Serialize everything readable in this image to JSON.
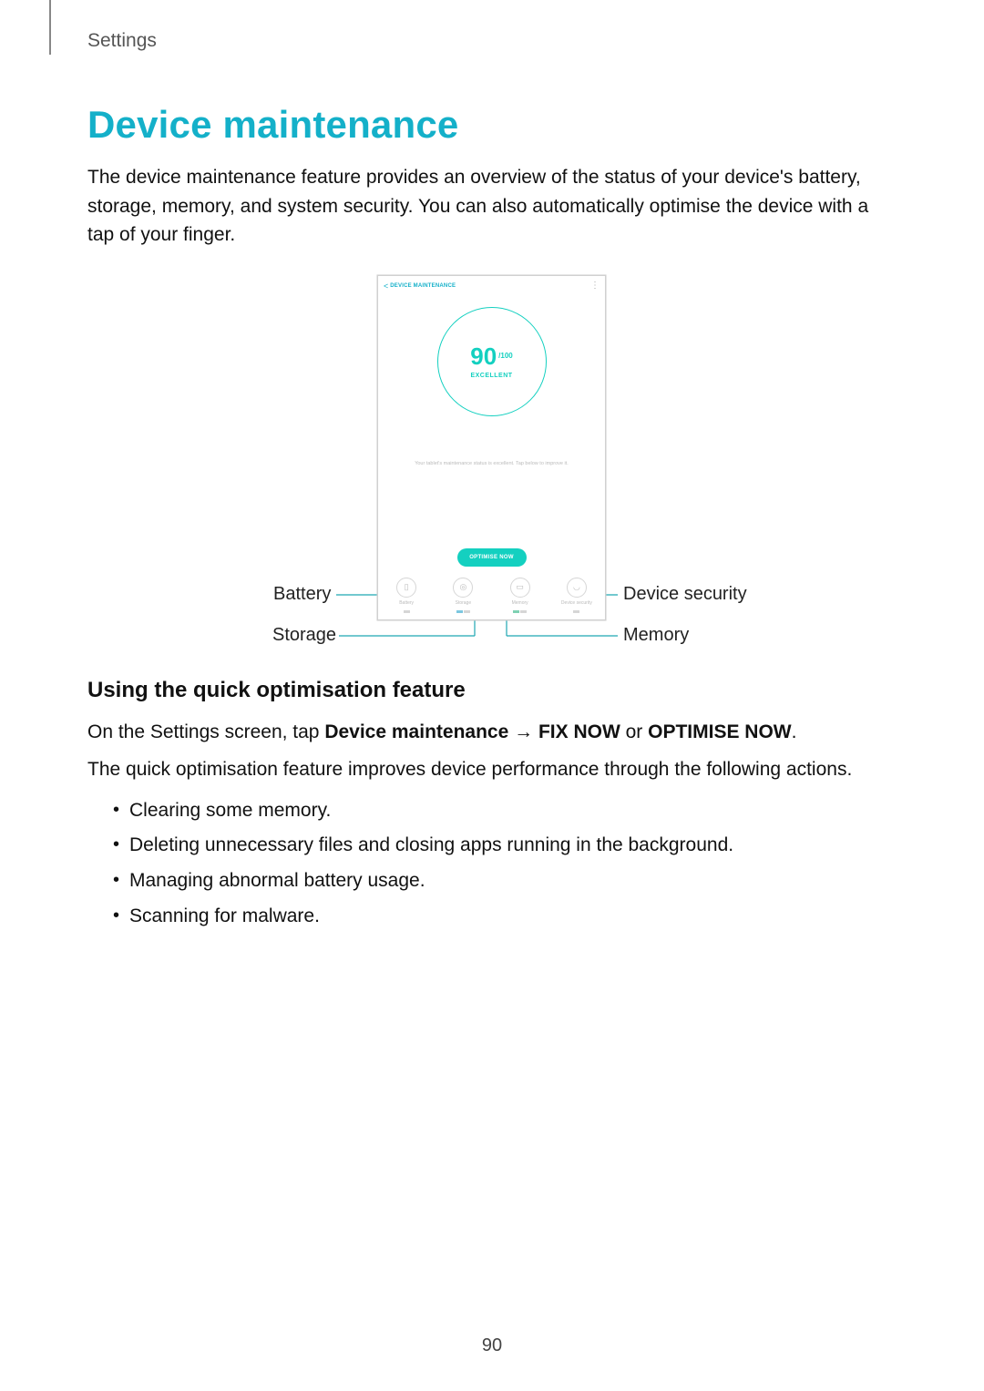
{
  "breadcrumb": "Settings",
  "heading": "Device maintenance",
  "intro": "The device maintenance feature provides an overview of the status of your device's battery, storage, memory, and system security. You can also automatically optimise the device with a tap of your finger.",
  "screenshot": {
    "title": "DEVICE MAINTENANCE",
    "back": "<",
    "more": "⋮",
    "score": "90",
    "score_unit": "/100",
    "rating": "EXCELLENT",
    "message": "Your tablet's maintenance status is excellent. Tap below to improve it.",
    "button": "OPTIMISE NOW",
    "tabs": [
      {
        "icon": "battery-icon",
        "glyph": "▯",
        "label": "Battery"
      },
      {
        "icon": "storage-icon",
        "glyph": "◎",
        "label": "Storage"
      },
      {
        "icon": "memory-icon",
        "glyph": "▭",
        "label": "Memory"
      },
      {
        "icon": "security-icon",
        "glyph": "◡",
        "label": "Device security"
      }
    ]
  },
  "callouts": {
    "battery": "Battery",
    "storage": "Storage",
    "memory": "Memory",
    "security": "Device security"
  },
  "subheading": "Using the quick optimisation feature",
  "steps": {
    "line1_prefix": "On the Settings screen, tap ",
    "line1_bold1": "Device maintenance",
    "line1_arrow": " → ",
    "line1_bold2": "FIX NOW",
    "line1_or": " or ",
    "line1_bold3": "OPTIMISE NOW",
    "line1_suffix": ".",
    "line2": "The quick optimisation feature improves device performance through the following actions."
  },
  "actions": [
    "Clearing some memory.",
    "Deleting unnecessary files and closing apps running in the background.",
    "Managing abnormal battery usage.",
    "Scanning for malware."
  ],
  "page_number": "90"
}
